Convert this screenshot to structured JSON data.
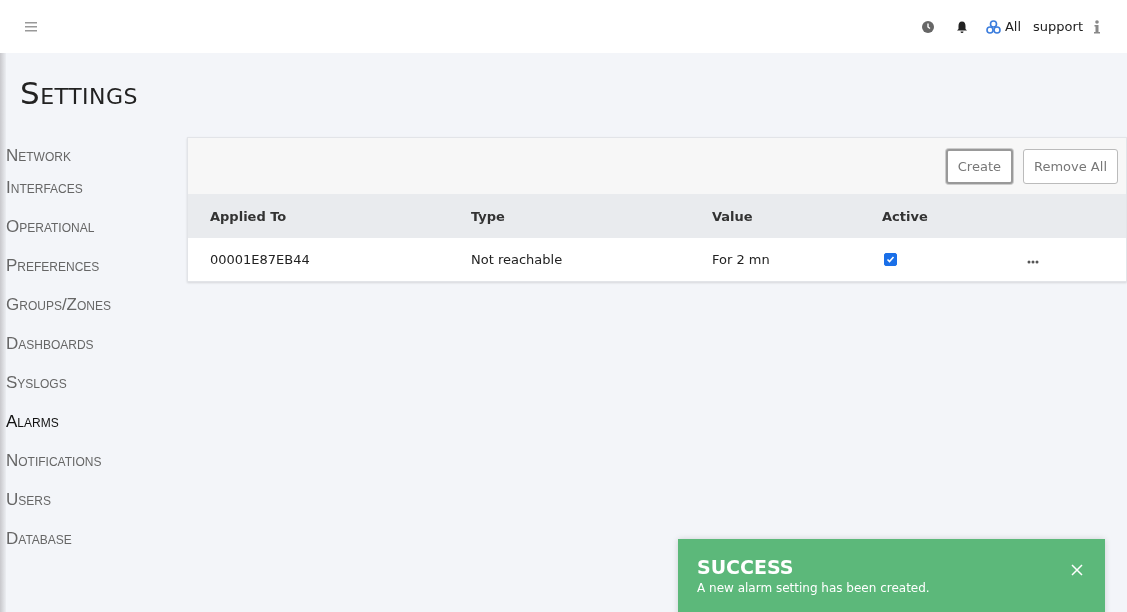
{
  "topbar": {
    "scope": "All",
    "user": "support"
  },
  "title": "Settings",
  "sidebar": {
    "items": [
      {
        "label": "Network Interfaces",
        "selected": false
      },
      {
        "label": "Operational",
        "selected": false
      },
      {
        "label": "Preferences",
        "selected": false
      },
      {
        "label": "Groups/Zones",
        "selected": false
      },
      {
        "label": "Dashboards",
        "selected": false
      },
      {
        "label": "Syslogs",
        "selected": false
      },
      {
        "label": "Alarms",
        "selected": true
      },
      {
        "label": "Notifications",
        "selected": false
      },
      {
        "label": "Users",
        "selected": false
      },
      {
        "label": "Database",
        "selected": false
      }
    ]
  },
  "toolbar": {
    "buttons": [
      {
        "label": "Create",
        "focused": true
      },
      {
        "label": "Remove All",
        "focused": false
      }
    ]
  },
  "table": {
    "columns": [
      "Applied To",
      "Type",
      "Value",
      "Active"
    ],
    "rows": [
      {
        "applied_to": "00001E87EB44",
        "type": "Not reachable",
        "value": "For 2 mn",
        "active": true
      }
    ]
  },
  "toast": {
    "title": "SUCCESS",
    "message": "A new alarm setting has been created."
  }
}
